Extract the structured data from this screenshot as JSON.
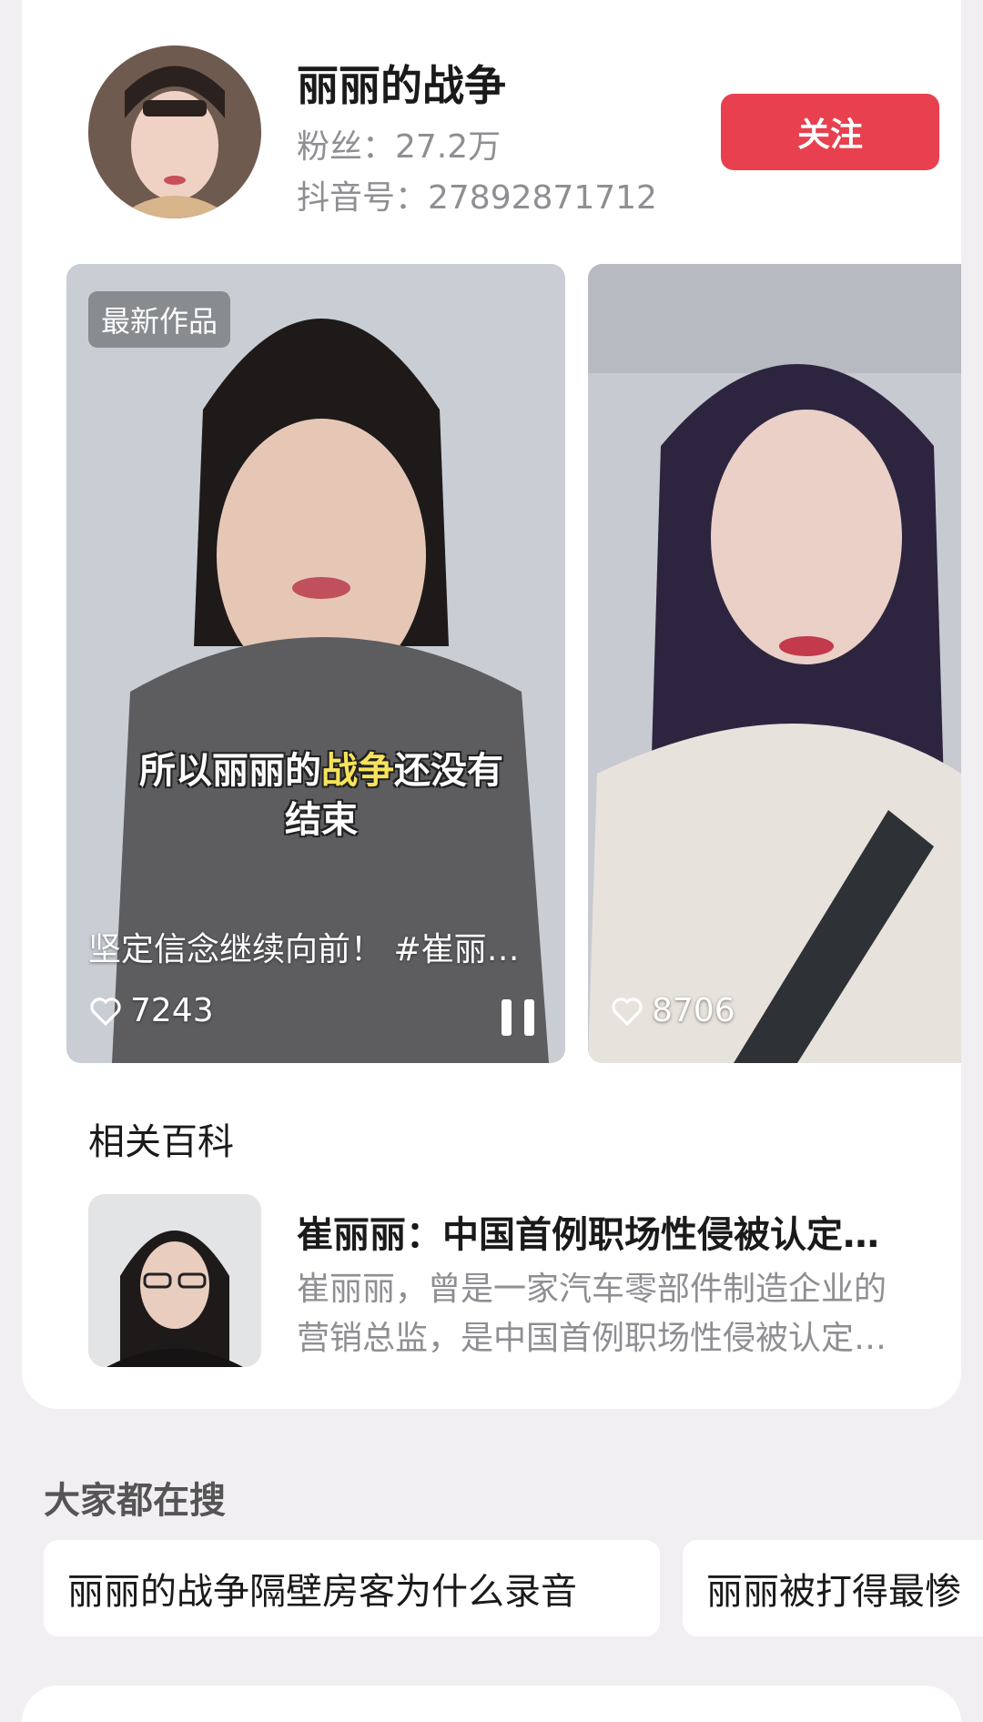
{
  "profile": {
    "name": "丽丽的战争",
    "fans": "粉丝：27.2万",
    "douyin_id": "抖音号：27892871712",
    "follow_label": "关注"
  },
  "videos": [
    {
      "badge": "最新作品",
      "subtitle_pre": "所以丽丽的",
      "subtitle_hl": "战争",
      "subtitle_post": "还没有",
      "subtitle_line2": "结束",
      "caption": "坚定信念继续向前！ #崔丽…",
      "likes": "7243"
    },
    {
      "likes": "8706"
    }
  ],
  "baike": {
    "section_title": "相关百科",
    "title": "崔丽丽：中国首例职场性侵被认定…",
    "desc_line1": "崔丽丽，曾是一家汽车零部件制造企业的",
    "desc_line2": "营销总监，是中国首例职场性侵被认定…"
  },
  "search": {
    "title": "大家都在搜",
    "chips": [
      "丽丽的战争隔壁房客为什么录音",
      "丽丽被打得最惨"
    ]
  },
  "colors": {
    "accent": "#e8404f",
    "background": "#f2eff2",
    "muted_text": "#8e8e93",
    "subtitle_highlight": "#f7e35b"
  },
  "icons": [
    "heart-icon",
    "pause-icon"
  ]
}
